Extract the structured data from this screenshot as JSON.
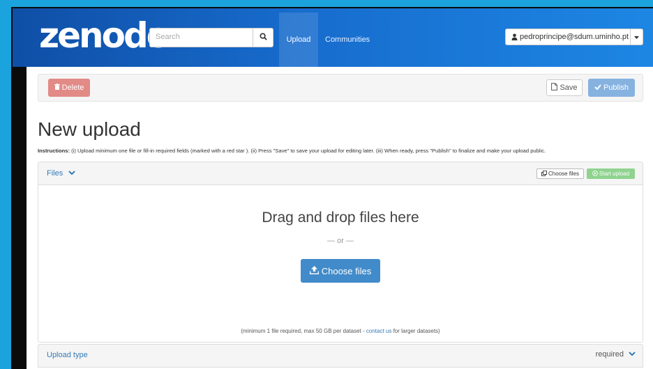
{
  "brand": {
    "logo_text": "zenodo",
    "accent": "#1d86e3",
    "nav_dark": "#0f4fa6"
  },
  "navbar": {
    "search": {
      "placeholder": "Search",
      "icon": "search-icon"
    },
    "links": [
      {
        "label": "Upload",
        "active": true
      },
      {
        "label": "Communities",
        "active": false
      }
    ],
    "user": {
      "email": "pedroprincipe@sdum.uminho.pt",
      "icon": "user-icon"
    }
  },
  "actions": {
    "delete_label": "Delete",
    "save_label": "Save",
    "publish_label": "Publish"
  },
  "page": {
    "title": "New upload",
    "instructions_label": "Instructions:",
    "instructions_text": " (i) Upload minimum one file or fill-in required fields (marked with a red star ). (ii) Press \"Save\" to save your upload for editing later. (iii) When ready, press \"Publish\" to finalize and make your upload public."
  },
  "files_panel": {
    "title": "Files",
    "choose_files_small": "Choose files",
    "start_upload": "Start upload",
    "drop_text": "Drag and drop files here",
    "or_text": "— or —",
    "choose_files_button": "Choose files",
    "note_prefix": "(minimum 1 file required, max 50 GB per dataset - ",
    "note_link": "contact us",
    "note_suffix": " for larger datasets)"
  },
  "upload_type": {
    "label": "Upload type",
    "required_text": "required"
  },
  "colors": {
    "delete": "#e18a86",
    "publish": "#86b2e0",
    "start_upload": "#8fd38f",
    "choose_files": "#428bca",
    "link": "#337ab7"
  }
}
